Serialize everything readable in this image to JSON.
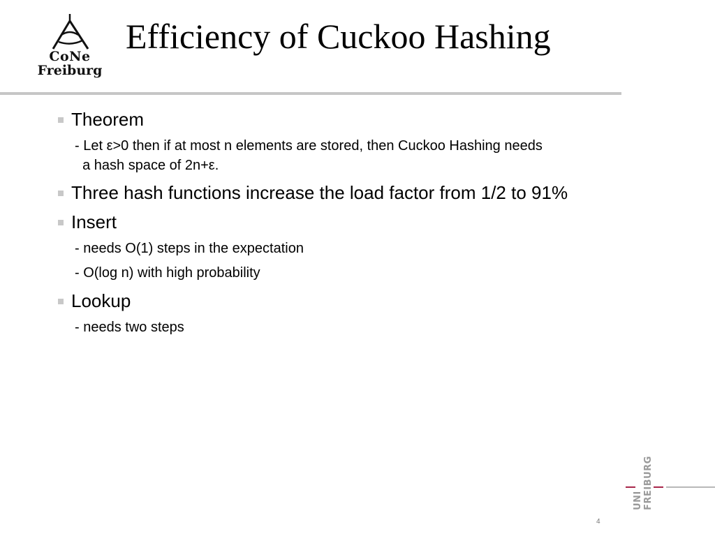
{
  "header": {
    "logo": {
      "icon": "cone-tower-icon",
      "line1": "CoNe",
      "line2": "Freiburg"
    },
    "title": "Efficiency of Cuckoo Hashing"
  },
  "content": {
    "bullets": [
      {
        "text": "Theorem",
        "subitems": [
          "- Let ε>0 then if at most n elements are stored, then Cuckoo Hashing needs",
          "  a hash space of 2n+ε."
        ]
      },
      {
        "text": "Three hash functions increase the load factor from 1/2 to 91%",
        "subitems": []
      },
      {
        "text": "Insert",
        "subitems": [
          "- needs O(1) steps in the expectation",
          "- O(log n) with high probability"
        ]
      },
      {
        "text": "Lookup",
        "subitems": [
          "- needs two steps"
        ]
      }
    ]
  },
  "footer": {
    "uni_logo": {
      "word1": "UNI",
      "word2": "FREIBURG",
      "accent_color": "#a8264a"
    },
    "page_number": "4"
  }
}
